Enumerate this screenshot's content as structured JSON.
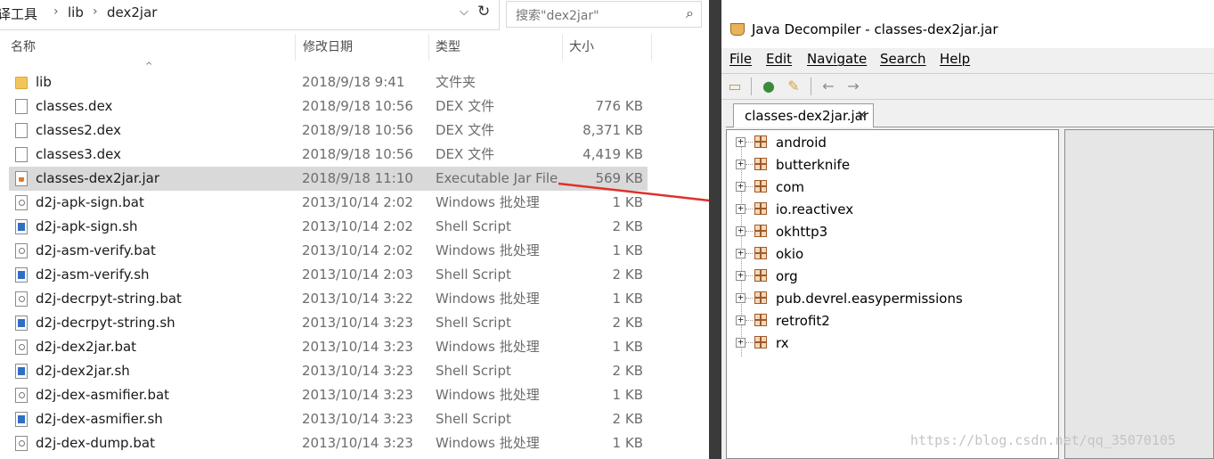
{
  "explorer": {
    "breadcrumb": [
      "编译工具",
      "lib",
      "dex2jar"
    ],
    "search_placeholder": "搜索\"dex2jar\"",
    "columns": {
      "name": "名称",
      "date": "修改日期",
      "type": "类型",
      "size": "大小"
    },
    "files": [
      {
        "name": "lib",
        "date": "2018/9/18 9:41",
        "type": "文件夹",
        "size": "",
        "icon": "folder-icon"
      },
      {
        "name": "classes.dex",
        "date": "2018/9/18 10:56",
        "type": "DEX 文件",
        "size": "776 KB",
        "icon": "file-icon"
      },
      {
        "name": "classes2.dex",
        "date": "2018/9/18 10:56",
        "type": "DEX 文件",
        "size": "8,371 KB",
        "icon": "file-icon"
      },
      {
        "name": "classes3.dex",
        "date": "2018/9/18 10:56",
        "type": "DEX 文件",
        "size": "4,419 KB",
        "icon": "file-icon"
      },
      {
        "name": "classes-dex2jar.jar",
        "date": "2018/9/18 11:10",
        "type": "Executable Jar File",
        "size": "569 KB",
        "icon": "jar-icon"
      },
      {
        "name": "d2j-apk-sign.bat",
        "date": "2013/10/14 2:02",
        "type": "Windows 批处理",
        "size": "1 KB",
        "icon": "bat-icon"
      },
      {
        "name": "d2j-apk-sign.sh",
        "date": "2013/10/14 2:02",
        "type": "Shell Script",
        "size": "2 KB",
        "icon": "sh-icon"
      },
      {
        "name": "d2j-asm-verify.bat",
        "date": "2013/10/14 2:02",
        "type": "Windows 批处理",
        "size": "1 KB",
        "icon": "bat-icon"
      },
      {
        "name": "d2j-asm-verify.sh",
        "date": "2013/10/14 2:03",
        "type": "Shell Script",
        "size": "2 KB",
        "icon": "sh-icon"
      },
      {
        "name": "d2j-decrpyt-string.bat",
        "date": "2013/10/14 3:22",
        "type": "Windows 批处理",
        "size": "1 KB",
        "icon": "bat-icon"
      },
      {
        "name": "d2j-decrpyt-string.sh",
        "date": "2013/10/14 3:23",
        "type": "Shell Script",
        "size": "2 KB",
        "icon": "sh-icon"
      },
      {
        "name": "d2j-dex2jar.bat",
        "date": "2013/10/14 3:23",
        "type": "Windows 批处理",
        "size": "1 KB",
        "icon": "bat-icon"
      },
      {
        "name": "d2j-dex2jar.sh",
        "date": "2013/10/14 3:23",
        "type": "Shell Script",
        "size": "2 KB",
        "icon": "sh-icon"
      },
      {
        "name": "d2j-dex-asmifier.bat",
        "date": "2013/10/14 3:23",
        "type": "Windows 批处理",
        "size": "1 KB",
        "icon": "bat-icon"
      },
      {
        "name": "d2j-dex-asmifier.sh",
        "date": "2013/10/14 3:23",
        "type": "Shell Script",
        "size": "2 KB",
        "icon": "sh-icon"
      },
      {
        "name": "d2j-dex-dump.bat",
        "date": "2013/10/14 3:23",
        "type": "Windows 批处理",
        "size": "1 KB",
        "icon": "bat-icon"
      }
    ],
    "selected_file": "classes-dex2jar.jar"
  },
  "decompiler": {
    "title": "Java Decompiler - classes-dex2jar.jar",
    "menu": [
      "File",
      "Edit",
      "Navigate",
      "Search",
      "Help"
    ],
    "toolbar_icons": [
      "open-folder-icon",
      "open-type-icon",
      "search-icon",
      "back-arrow-icon",
      "forward-arrow-icon"
    ],
    "tab_label": "classes-dex2jar.jar",
    "tab_close": "×",
    "packages": [
      "android",
      "butterknife",
      "com",
      "io.reactivex",
      "okhttp3",
      "okio",
      "org",
      "pub.devrel.easypermissions",
      "retrofit2",
      "rx"
    ]
  },
  "annotation": {
    "arrow_color": "#e0302a"
  },
  "watermark": "https://blog.csdn.net/qq_35070105"
}
